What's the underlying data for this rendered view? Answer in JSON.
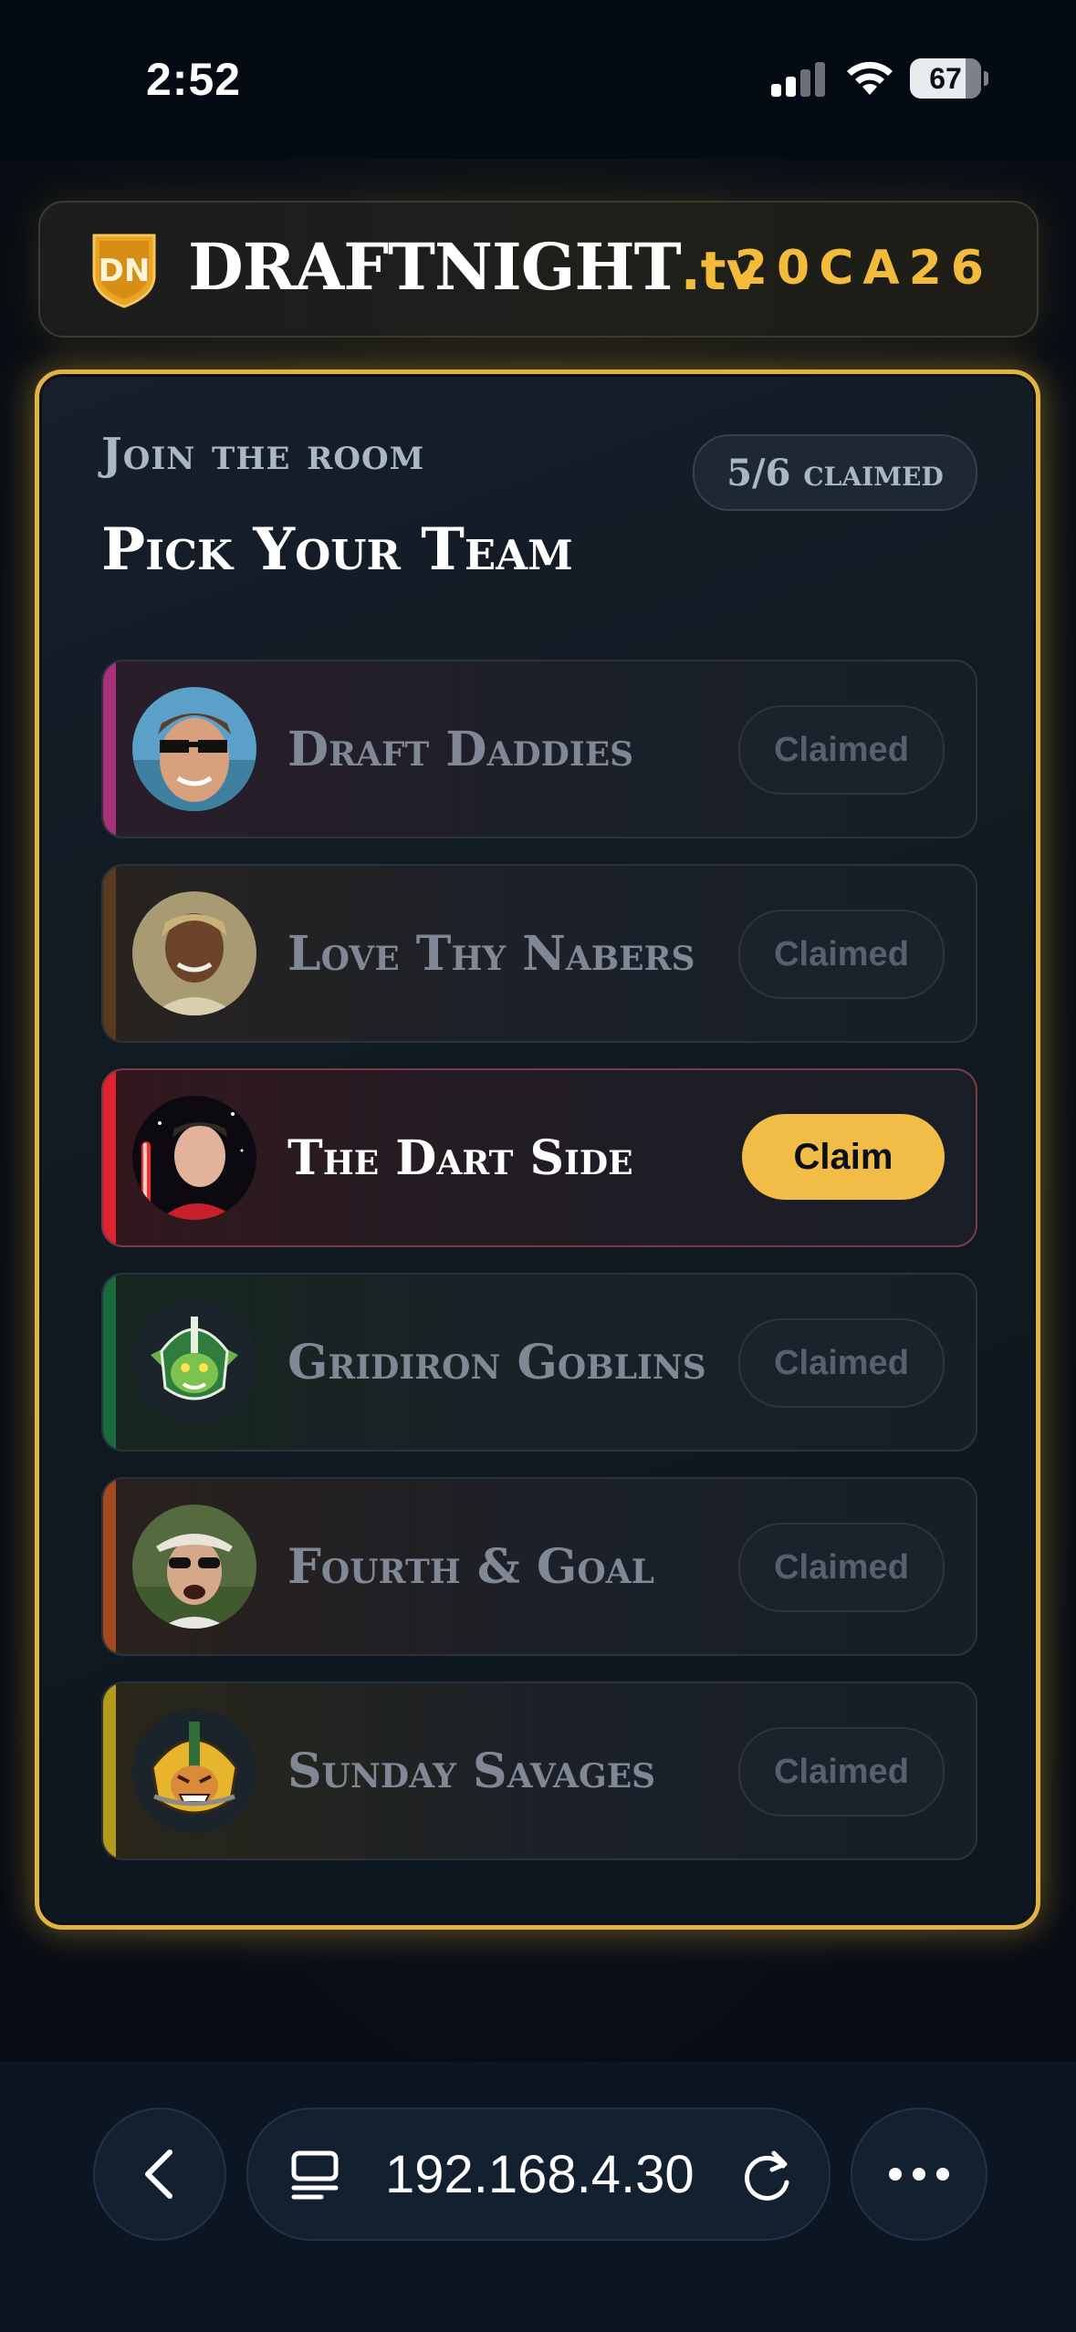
{
  "status_bar": {
    "time": "2:52",
    "battery": "67"
  },
  "header": {
    "brand_main": "DRAFTNIGHT",
    "brand_suffix": ".tv",
    "room_code": "20CA26",
    "logo_letters": "DN"
  },
  "panel": {
    "join_label": "Join the room",
    "claimed_count": "5/6 claimed",
    "title": "Pick Your Team"
  },
  "teams": [
    {
      "name": "Draft Daddies",
      "button": "Claimed",
      "accent": "#a8327a"
    },
    {
      "name": "Love Thy Nabers",
      "button": "Claimed",
      "accent": "#5a3a1f"
    },
    {
      "name": "The Dart Side",
      "button": "Claim",
      "accent": "#e0232e"
    },
    {
      "name": "Gridiron Goblins",
      "button": "Claimed",
      "accent": "#176b3c"
    },
    {
      "name": "Fourth & Goal",
      "button": "Claimed",
      "accent": "#a4491c"
    },
    {
      "name": "Sunday Savages",
      "button": "Claimed",
      "accent": "#b39a1a"
    }
  ],
  "browser": {
    "url": "192.168.4.30"
  }
}
